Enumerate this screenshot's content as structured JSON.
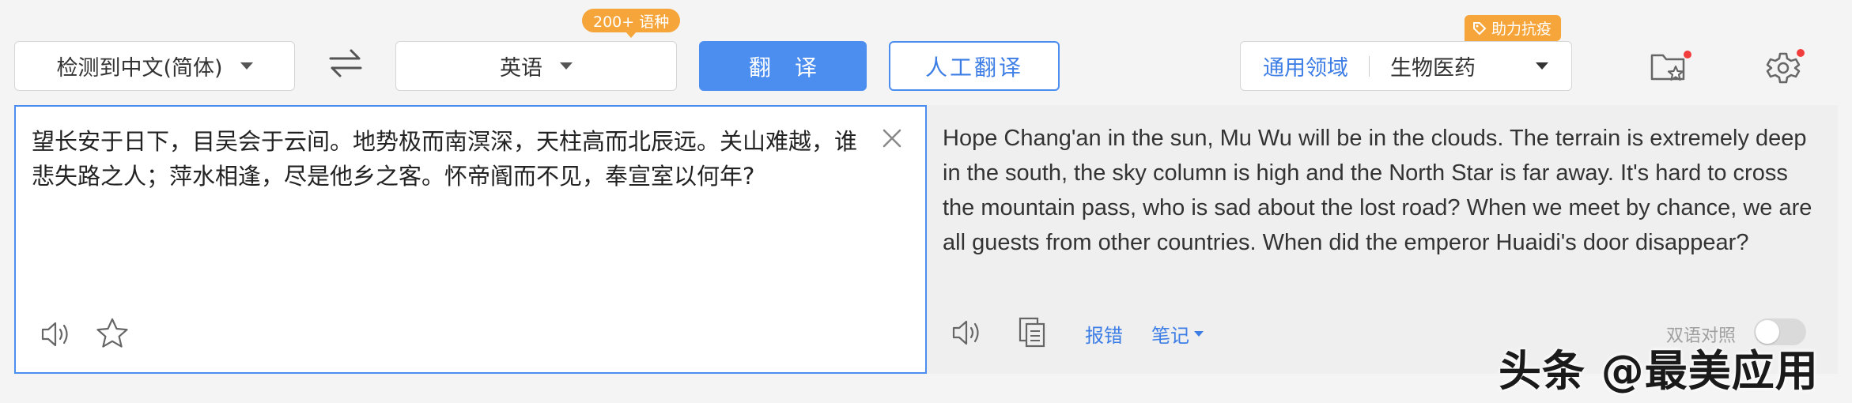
{
  "toolbar": {
    "source_lang": "检测到中文(简体)",
    "swap_icon": "swap-arrows-icon",
    "target_lang": "英语",
    "lang_badge": "200+ 语种",
    "translate_button": "翻译",
    "human_translate_button": "人工翻译",
    "domain_general": "通用领域",
    "domain_selected": "生物医药",
    "domain_badge": "助力抗疫",
    "favorites_icon": "folder-star-icon",
    "settings_icon": "gear-icon"
  },
  "source": {
    "text": "望长安于日下，目吴会于云间。地势极而南溟深，天柱高而北辰远。关山难越，谁悲失路之人；萍水相逢，尽是他乡之客。怀帝阍而不见，奉宣室以何年?",
    "clear_icon": "close-icon",
    "speaker_icon": "speaker-icon",
    "star_icon": "star-icon"
  },
  "result": {
    "text": "Hope Chang'an in the sun, Mu Wu will be in the clouds. The terrain is extremely deep in the south, the sky column is high and the North Star is far away. It's hard to cross the mountain pass, who is sad about the lost road? When we meet by chance, we are all guests from other countries. When did the emperor Huaidi's door disappear?",
    "speaker_icon": "speaker-icon",
    "copy_icon": "copy-icon",
    "report_label": "报错",
    "notes_label": "笔记",
    "bilingual_label": "双语对照",
    "bilingual_on": false
  },
  "watermark": "头条 @最美应用",
  "colors": {
    "accent": "#4c8ef0",
    "badge": "#f6a53a",
    "notification": "#f23d3d"
  }
}
